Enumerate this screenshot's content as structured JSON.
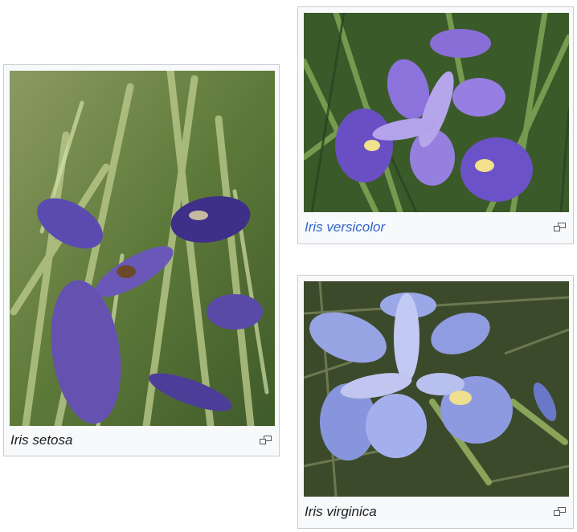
{
  "figures": [
    {
      "species": "Iris setosa",
      "is_link": false,
      "enlarge_icon": "magnify-clip-icon"
    },
    {
      "species": "Iris versicolor",
      "is_link": true,
      "enlarge_icon": "magnify-clip-icon"
    },
    {
      "species": "Iris virginica",
      "is_link": false,
      "enlarge_icon": "magnify-clip-icon"
    }
  ],
  "colors": {
    "link": "#3366cc",
    "text": "#202122",
    "frame_bg": "#f8f9fa",
    "frame_border": "#c8ccd1"
  }
}
